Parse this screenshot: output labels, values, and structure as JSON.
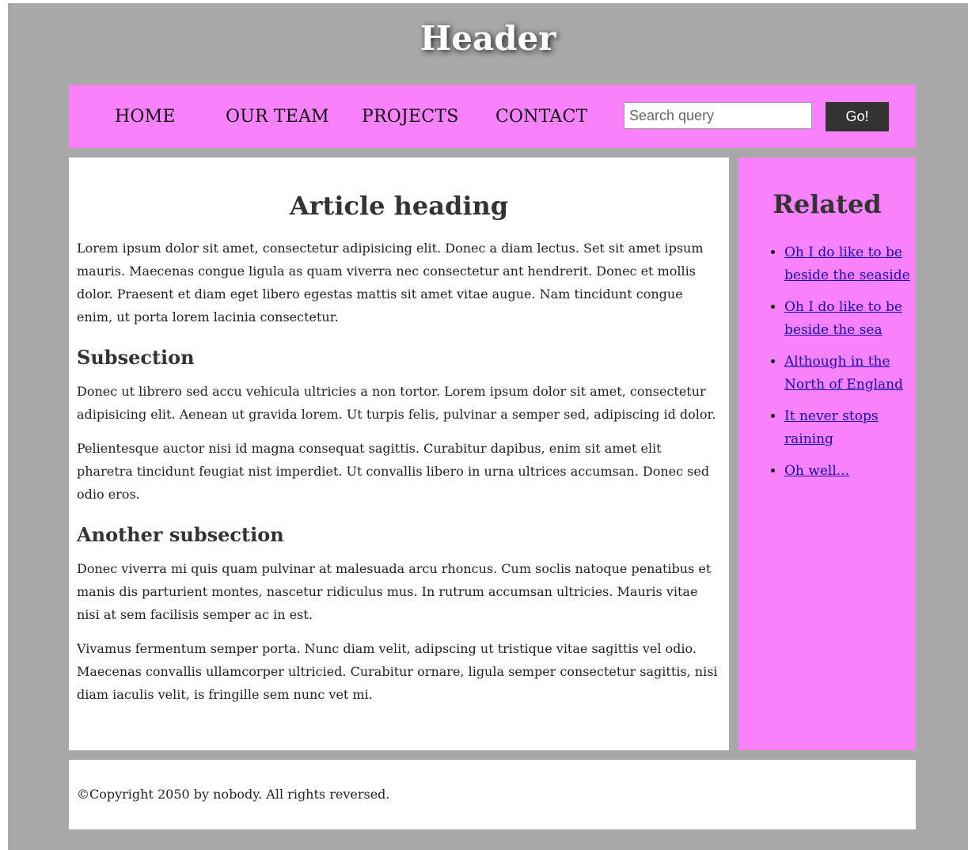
{
  "header": {
    "title": "Header"
  },
  "nav": {
    "links": [
      "HOME",
      "OUR TEAM",
      "PROJECTS",
      "CONTACT"
    ],
    "search": {
      "placeholder": "Search query",
      "value": ""
    },
    "go_label": "Go!"
  },
  "main": {
    "heading": "Article heading",
    "paragraphs": [
      "Lorem ipsum dolor sit amet, consectetur adipisicing elit. Donec a diam lectus. Set sit amet ipsum mauris. Maecenas congue ligula as quam viverra nec consectetur ant hendrerit. Donec et mollis dolor. Praesent et diam eget libero egestas mattis sit amet vitae augue. Nam tincidunt congue enim, ut porta lorem lacinia consectetur.",
      "Donec ut librero sed accu vehicula ultricies a non tortor. Lorem ipsum dolor sit amet, consectetur adipisicing elit. Aenean ut gravida lorem. Ut turpis felis, pulvinar a semper sed, adipiscing id dolor.",
      "Pelientesque auctor nisi id magna consequat sagittis. Curabitur dapibus, enim sit amet elit pharetra tincidunt feugiat nist imperdiet. Ut convallis libero in urna ultrices accumsan. Donec sed odio eros.",
      "Donec viverra mi quis quam pulvinar at malesuada arcu rhoncus. Cum soclis natoque penatibus et manis dis parturient montes, nascetur ridiculus mus. In rutrum accumsan ultricies. Mauris vitae nisi at sem facilisis semper ac in est.",
      "Vivamus fermentum semper porta. Nunc diam velit, adipscing ut tristique vitae sagittis vel odio. Maecenas convallis ullamcorper ultricied. Curabitur ornare, ligula semper consectetur sagittis, nisi diam iaculis velit, is fringille sem nunc vet mi."
    ],
    "subsections": [
      "Subsection",
      "Another subsection"
    ]
  },
  "aside": {
    "heading": "Related",
    "links": [
      "Oh I do like to be beside the seaside",
      "Oh I do like to be beside the sea",
      "Although in the North of England",
      "It never stops raining",
      "Oh well..."
    ]
  },
  "footer": {
    "text": "©Copyright 2050 by nobody. All rights reversed."
  },
  "colors": {
    "page_background": "#a8a8a8",
    "nav_background": "#f782fb",
    "aside_background": "#f782fb",
    "button_background": "#333333",
    "link": "#1a0dab"
  }
}
